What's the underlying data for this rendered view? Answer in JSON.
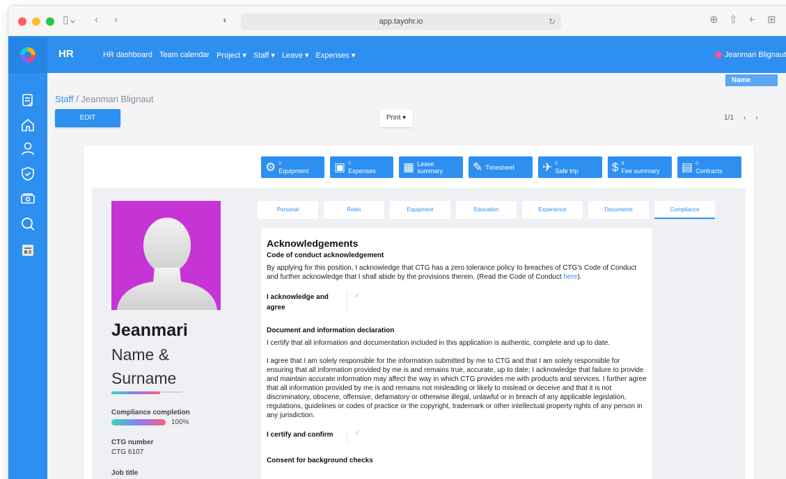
{
  "browser": {
    "url": "app.tayohr.io",
    "traffic_colors": [
      "#ff5f57",
      "#febc2e",
      "#28c840"
    ]
  },
  "app": {
    "title": "HR",
    "nav": [
      "HR dashboard",
      "Team calendar",
      "Project ▾",
      "Staff ▾",
      "Leave ▾",
      "Expenses ▾"
    ],
    "user_name": "Jeanmari Blignaut",
    "tooltip": "Name",
    "accent": "#2d8ff0"
  },
  "sidebar": {
    "icons": [
      "clipboard-icon",
      "home-icon",
      "user-icon",
      "shield-icon",
      "money-icon",
      "search-icon",
      "report-icon"
    ]
  },
  "breadcrumb": {
    "parent": "Staff",
    "separator": "/",
    "current": "Jeanmari Blignaut"
  },
  "toolbar": {
    "edit_label": "EDIT",
    "print_label": "Print ▾",
    "pager_text": "1/1",
    "prev": "‹",
    "next": "›"
  },
  "quick_actions": [
    {
      "count": "0",
      "label": "Equipment",
      "icon": "⚙"
    },
    {
      "count": "0",
      "label": "Expenses",
      "icon": "▣"
    },
    {
      "count": "Leave",
      "label": "summary",
      "icon": "▦"
    },
    {
      "count": "",
      "label": "Timesheet",
      "icon": "✎"
    },
    {
      "count": "0",
      "label": "Safe trip",
      "icon": "✈"
    },
    {
      "count": "0",
      "label": "Fee summary",
      "icon": "$"
    },
    {
      "count": "0",
      "label": "Contracts",
      "icon": "▤"
    }
  ],
  "profile": {
    "first_name": "Jeanmari",
    "subtitle": "Name & Surname",
    "compliance_label": "Compliance completion",
    "compliance_value": "100%",
    "compliance_fraction": 1.0,
    "ctg_label": "CTG number",
    "ctg_value": "CTG 6107",
    "job_label": "Job title"
  },
  "tabs": [
    "Personal",
    "Roles",
    "Equipment",
    "Education",
    "Experience",
    "Documents",
    "Compliance"
  ],
  "active_tab": "Compliance",
  "compliance": {
    "heading": "Acknowledgements",
    "coc_heading": "Code of conduct acknowledgement",
    "coc_text": "By applying for this position, I acknowledge that CTG has a zero tolerance policy to breaches of CTG's Code of Conduct and further acknowledge that I shall abide by the provisions therein. (Read the Code of Conduct ",
    "coc_link": "here",
    "coc_end": ").",
    "ack_label": "I acknowledge and agree",
    "check_mark": "✓",
    "decl_heading": "Document and information declaration",
    "decl_text1": "I certify that all information and documentation included in this application is authentic, complete and up to date.",
    "decl_text2": "I agree that I am solely responsible for the information submitted by me to CTG and that I am solely responsible for ensuring that all information provided by me is and remains true, accurate, up to date; I acknowledge that failure to provide and maintain accurate information may affect the way in which CTG provides me with products and services. I further agree that all information provided by me is and remains not misleading or likely to mislead or deceive and that it is not discriminatory, obscene, offensive, defamatory or otherwise illegal, unlawful or in breach of any applicable legislation, regulations, guidelines or codes of practice or the copyright, trademark or other intellectual property rights of any person in any jurisdiction.",
    "certify_label": "I certify and confirm",
    "consent_heading": "Consent for background checks"
  }
}
